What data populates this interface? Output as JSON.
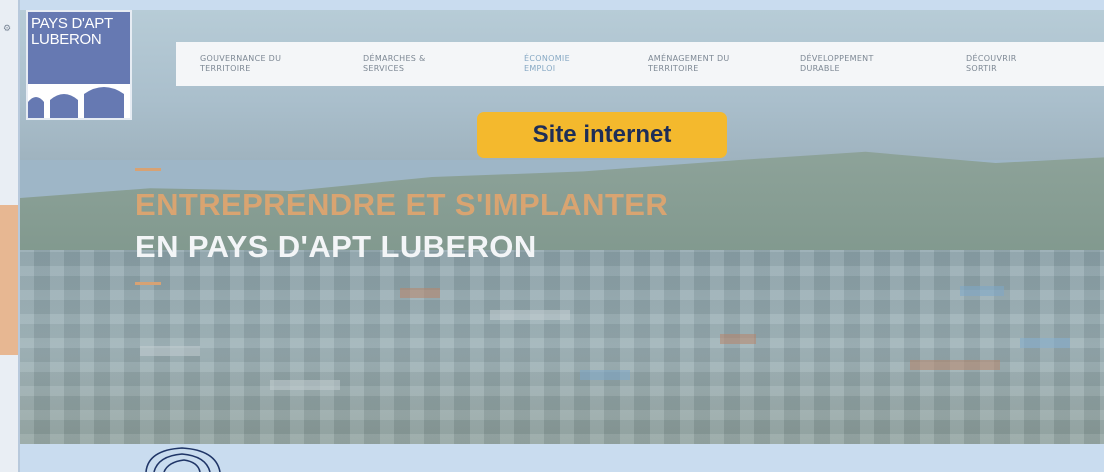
{
  "logo": {
    "line1": "PAYS D'APT",
    "line2": "LUBERON"
  },
  "nav": {
    "items": [
      {
        "line1": "GOUVERNANCE DU",
        "line2": "TERRITOIRE"
      },
      {
        "line1": "DÉMARCHES &",
        "line2": "SERVICES"
      },
      {
        "line1": "ÉCONOMIE",
        "line2": "EMPLOI"
      },
      {
        "line1": "AMÉNAGEMENT DU",
        "line2": "TERRITOIRE"
      },
      {
        "line1": "DÉVELOPPEMENT",
        "line2": "DURABLE"
      },
      {
        "line1": "DÉCOUVRIR",
        "line2": "SORTIR"
      }
    ]
  },
  "badge": {
    "label": "Site internet",
    "color": "#f4b92d"
  },
  "hero": {
    "line1": "ENTREPRENDRE ET S'IMPLANTER",
    "line2": "EN PAYS D'APT LUBERON",
    "accent_color": "#d9a471"
  }
}
